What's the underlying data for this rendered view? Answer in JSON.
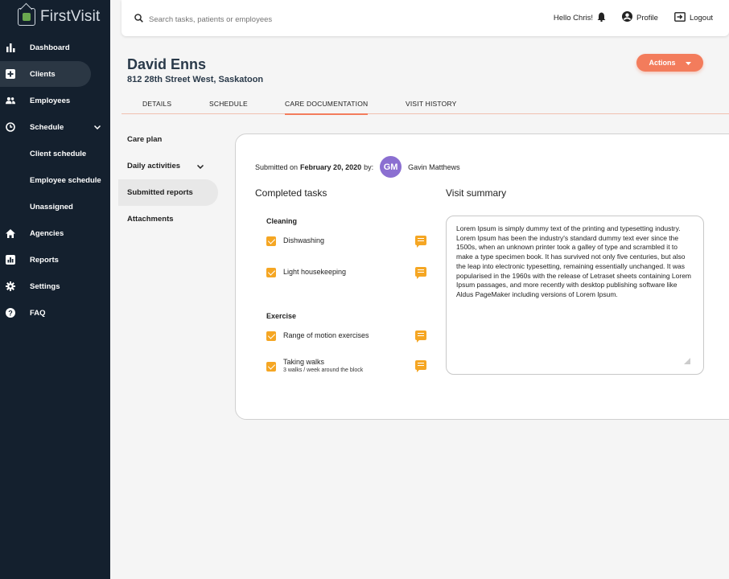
{
  "app": {
    "name": "FirstVisit"
  },
  "sidebar": {
    "items": [
      {
        "label": "Dashboard",
        "icon": "bar-chart-icon"
      },
      {
        "label": "Clients",
        "icon": "plus-square-icon",
        "active": true
      },
      {
        "label": "Employees",
        "icon": "people-icon"
      },
      {
        "label": "Schedule",
        "icon": "clock-icon"
      },
      {
        "label": "Client schedule"
      },
      {
        "label": "Employee schedule"
      },
      {
        "label": "Unassigned"
      },
      {
        "label": "Agencies",
        "icon": "home-icon"
      },
      {
        "label": "Reports",
        "icon": "report-icon"
      },
      {
        "label": "Settings",
        "icon": "gear-icon"
      },
      {
        "label": "FAQ",
        "icon": "help-icon"
      }
    ]
  },
  "topbar": {
    "search_placeholder": "Search tasks, patients or employees",
    "greeting": "Hello Chris!",
    "profile_label": "Profile",
    "logout_label": "Logout"
  },
  "client": {
    "name": "David Enns",
    "address": "812 28th Street West, Saskatoon"
  },
  "actions_label": "Actions",
  "tabs": [
    "DETAILS",
    "SCHEDULE",
    "CARE DOCUMENTATION",
    "VISIT HISTORY"
  ],
  "subnav": [
    "Care plan",
    "Daily activities",
    "Submitted reports",
    "Attachments"
  ],
  "report": {
    "submitted_prefix": "Submitted on",
    "submitted_date": "February 20, 2020",
    "submitted_by": "by:",
    "avatar_initials": "GM",
    "author": "Gavin Matthews",
    "completed_title": "Completed tasks",
    "summary_title": "Visit summary",
    "groups": [
      {
        "label": "Cleaning",
        "tasks": [
          {
            "label": "Dishwashing"
          },
          {
            "label": "Light housekeeping"
          }
        ]
      },
      {
        "label": "Exercise",
        "tasks": [
          {
            "label": "Range of motion exercises"
          },
          {
            "label": "Taking walks",
            "note": "3 walks / week around the block"
          }
        ]
      }
    ],
    "summary_text": "Lorem Ipsum is simply dummy text of the printing and typesetting industry. Lorem Ipsum has been the industry's standard dummy text ever since the 1500s, when an unknown printer took a galley of type and scrambled it to make a type specimen book. It has survived not only five centuries, but also the leap into electronic typesetting, remaining essentially unchanged. It was popularised in the 1960s with the release of Letraset sheets containing Lorem Ipsum passages, and more recently with desktop publishing software like Aldus PageMaker including versions of Lorem Ipsum."
  },
  "colors": {
    "sidebar_bg": "#14202e",
    "accent": "#f37c5c",
    "check": "#f5a623",
    "avatar": "#8b6fd1"
  }
}
